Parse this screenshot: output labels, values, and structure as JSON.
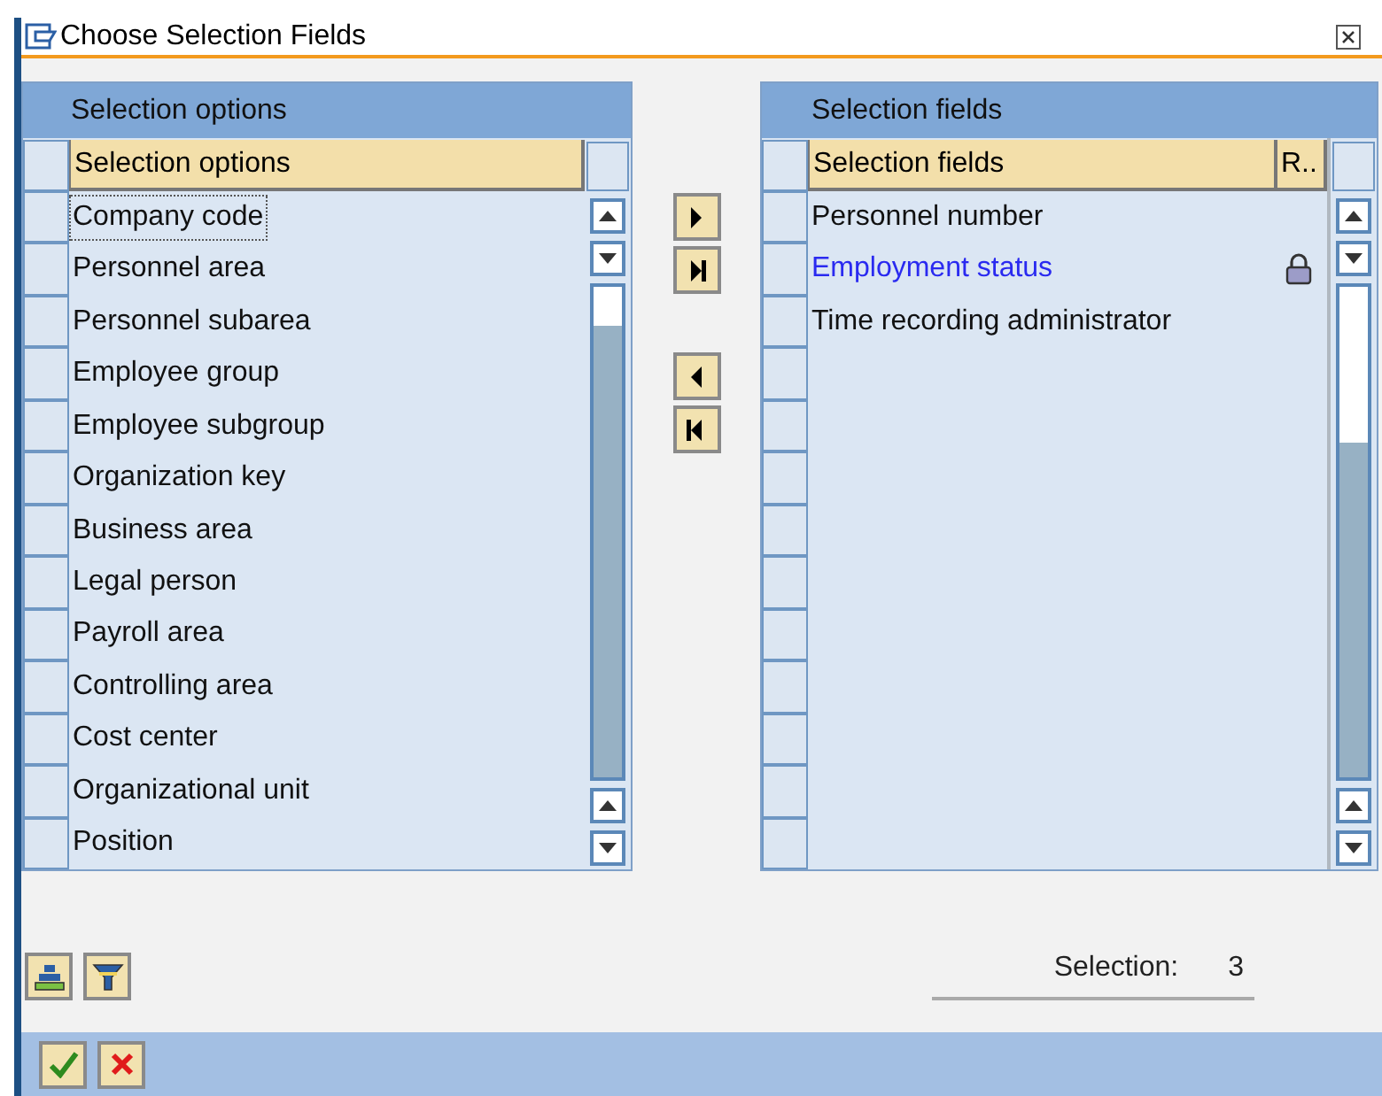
{
  "window": {
    "title": "Choose Selection Fields"
  },
  "left_panel": {
    "title": "Selection options",
    "column_header": "Selection options",
    "rows": [
      {
        "label": "Company code",
        "focused": true
      },
      {
        "label": "Personnel area",
        "focused": false
      },
      {
        "label": "Personnel subarea",
        "focused": false
      },
      {
        "label": "Employee group",
        "focused": false
      },
      {
        "label": "Employee subgroup",
        "focused": false
      },
      {
        "label": "Organization key",
        "focused": false
      },
      {
        "label": "Business area",
        "focused": false
      },
      {
        "label": "Legal person",
        "focused": false
      },
      {
        "label": "Payroll area",
        "focused": false
      },
      {
        "label": "Controlling area",
        "focused": false
      },
      {
        "label": "Cost center",
        "focused": false
      },
      {
        "label": "Organizational unit",
        "focused": false
      },
      {
        "label": "Position",
        "focused": false
      }
    ]
  },
  "right_panel": {
    "title": "Selection fields",
    "column_headers": [
      "Selection fields",
      "R.."
    ],
    "rows": [
      {
        "label": "Personnel number",
        "locked": false
      },
      {
        "label": "Employment status",
        "locked": true
      },
      {
        "label": "Time recording administrator",
        "locked": false
      }
    ]
  },
  "selection": {
    "label": "Selection:",
    "value": "3"
  }
}
